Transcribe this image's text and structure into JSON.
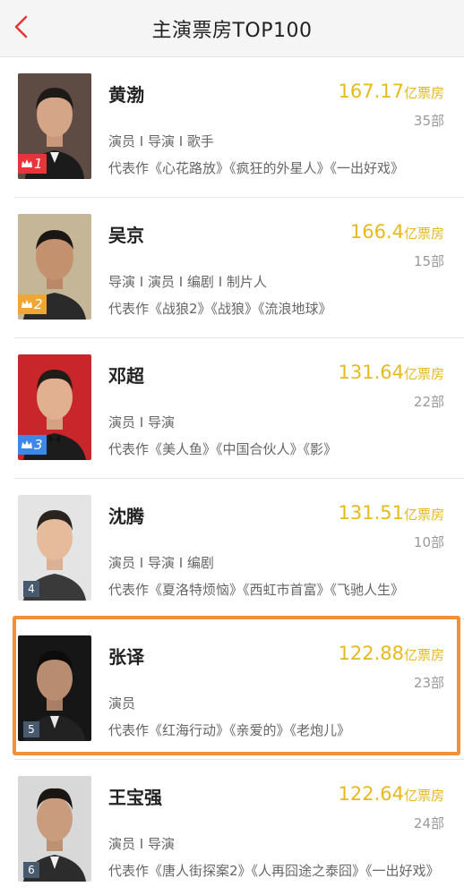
{
  "header": {
    "title": "主演票房TOP100"
  },
  "colors": {
    "accent": "#e6b91e",
    "back": "#e23a3a",
    "rank1": "#e8353b",
    "rank2": "#f0a632",
    "rank3": "#3d87e8",
    "rank_other": "#4a5a6e",
    "highlight": "#f0913a"
  },
  "actors": [
    {
      "rank": "1",
      "rank_icon": "crown-icon",
      "name": "黄渤",
      "box_value": "167.17",
      "box_unit": "亿票房",
      "count": "35部",
      "roles": "演员 I 导演 I 歌手",
      "works": "代表作《心花路放》《疯狂的外星人》《一出好戏》"
    },
    {
      "rank": "2",
      "rank_icon": "crown-icon",
      "name": "吴京",
      "box_value": "166.4",
      "box_unit": "亿票房",
      "count": "15部",
      "roles": "导演 I 演员 I 编剧 I 制片人",
      "works": "代表作《战狼2》《战狼》《流浪地球》"
    },
    {
      "rank": "3",
      "rank_icon": "crown-icon",
      "name": "邓超",
      "box_value": "131.64",
      "box_unit": "亿票房",
      "count": "22部",
      "roles": "演员 I 导演",
      "works": "代表作《美人鱼》《中国合伙人》《影》"
    },
    {
      "rank": "4",
      "name": "沈腾",
      "box_value": "131.51",
      "box_unit": "亿票房",
      "count": "10部",
      "roles": "演员 I 导演 I 编剧",
      "works": "代表作《夏洛特烦恼》《西虹市首富》《飞驰人生》"
    },
    {
      "rank": "5",
      "name": "张译",
      "box_value": "122.88",
      "box_unit": "亿票房",
      "count": "23部",
      "roles": "演员",
      "works": "代表作《红海行动》《亲爱的》《老炮儿》",
      "highlighted": true
    },
    {
      "rank": "6",
      "name": "王宝强",
      "box_value": "122.64",
      "box_unit": "亿票房",
      "count": "24部",
      "roles": "演员 I 导演",
      "works": "代表作《唐人街探案2》《人再囧途之泰囧》《一出好戏》"
    }
  ]
}
